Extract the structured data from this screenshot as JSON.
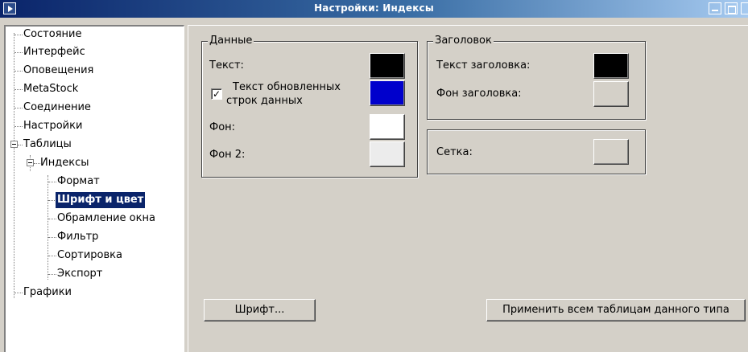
{
  "window": {
    "title": "Настройки: Индексы"
  },
  "tree": {
    "items": [
      {
        "label": "Состояние"
      },
      {
        "label": "Интерфейс"
      },
      {
        "label": "Оповещения"
      },
      {
        "label": "MetaStock"
      },
      {
        "label": "Соединение"
      },
      {
        "label": "Настройки"
      },
      {
        "label": "Таблицы",
        "expanded": true
      },
      {
        "label": "Индексы",
        "expanded": true
      },
      {
        "label": "Формат"
      },
      {
        "label": "Шрифт и цвет",
        "selected": true
      },
      {
        "label": "Обрамление окна"
      },
      {
        "label": "Фильтр"
      },
      {
        "label": "Сортировка"
      },
      {
        "label": "Экспорт"
      },
      {
        "label": "Графики"
      }
    ]
  },
  "data_group": {
    "legend": "Данные",
    "text_label": "Текст:",
    "text_color": "#000000",
    "updated_label_line1": "Текст обновленных",
    "updated_label_line2": "строк данных",
    "updated_checked": true,
    "updated_color": "#0000cc",
    "bg_label": "Фон:",
    "bg_color": "#ffffff",
    "bg2_label": "Фон 2:",
    "bg2_color": "#ececec"
  },
  "header_group": {
    "legend": "Заголовок",
    "title_text_label": "Текст заголовка:",
    "title_text_color": "#000000",
    "title_bg_label": "Фон заголовка:",
    "title_bg_color": "#d4d0c8"
  },
  "grid_group": {
    "grid_label": "Сетка:",
    "grid_color": "#d4d0c8"
  },
  "buttons": {
    "font_label": "Шрифт...",
    "apply_all_label": "Применить всем таблицам данного типа"
  }
}
